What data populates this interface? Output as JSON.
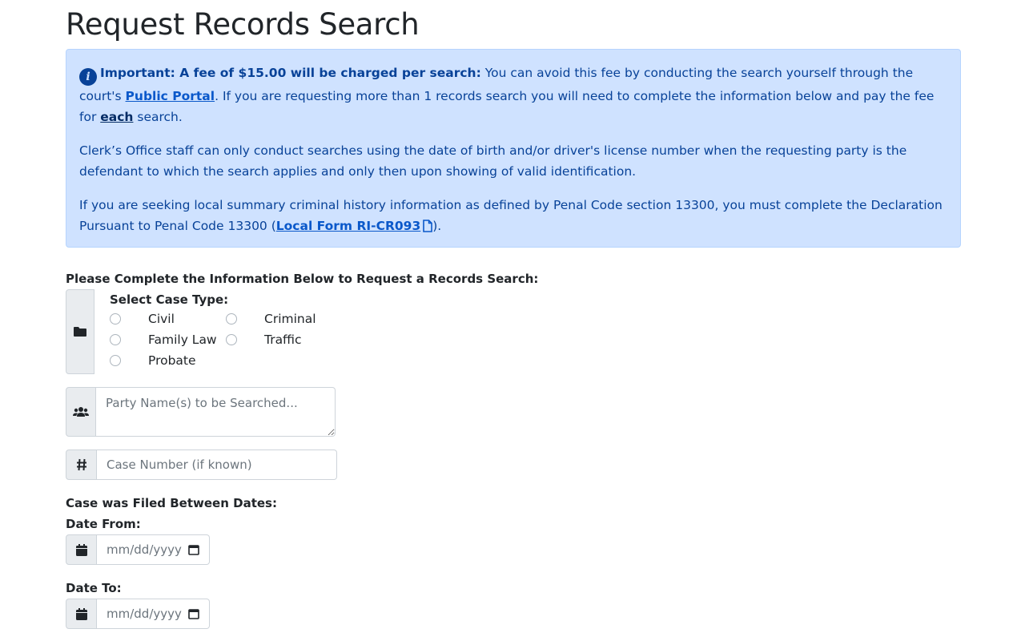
{
  "page": {
    "title": "Request Records Search"
  },
  "alert": {
    "icon": "info-circle-icon",
    "lead_bold": "Important: A fee of $15.00 will be charged per search:",
    "lead_rest": " You can avoid this fee by conducting the search yourself through the court's ",
    "portal_link": "Public Portal",
    "after_portal": ". If you are requesting more than 1 records search you will need to complete the information below and pay the fee for ",
    "each_link": "each",
    "after_each": " search.",
    "para2": "Clerk’s Office staff can only conduct searches using the date of birth and/or driver's license number when the requesting party is the defendant to which the search applies and only then upon showing of valid identification.",
    "para3_pre": "If you are seeking local summary criminal history information as defined by Penal Code section 13300, you must complete the Declaration Pursuant to Penal Code 13300 (",
    "form_link": "Local Form RI-CR093",
    "para3_post": ")."
  },
  "form": {
    "heading": "Please Complete the Information Below to Request a Records Search:",
    "case_type": {
      "icon": "folder-icon",
      "label": "Select Case Type:",
      "options": [
        "Civil",
        "Criminal",
        "Family Law",
        "Traffic",
        "Probate"
      ]
    },
    "party_names": {
      "icon": "users-icon",
      "placeholder": "Party Name(s) to be Searched..."
    },
    "case_number": {
      "icon": "hash-icon",
      "placeholder": "Case Number (if known)"
    },
    "date_range_label": "Case was Filed Between Dates:",
    "date_from": {
      "label": "Date From:",
      "icon": "calendar-icon",
      "placeholder": "mm/dd/yyyy"
    },
    "date_to": {
      "label": "Date To:",
      "icon": "calendar-icon",
      "placeholder": "mm/dd/yyyy"
    }
  }
}
